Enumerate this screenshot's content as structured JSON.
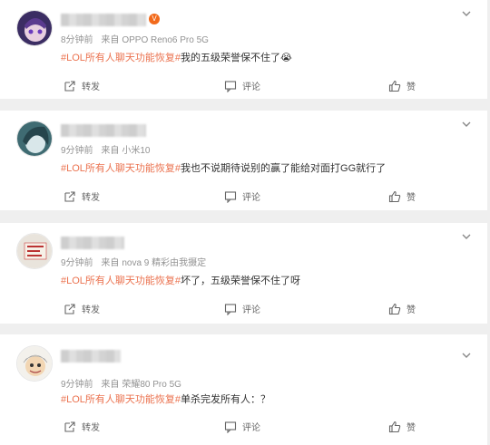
{
  "posts": [
    {
      "time": "8分钟前",
      "source_prefix": "来自",
      "source": "OPPO Reno6 Pro 5G",
      "topic": "#LOL所有人聊天功能恢复#",
      "text": "我的五级荣誉保不住了😭",
      "share_label": "转发",
      "comment_label": "评论",
      "like_label": "赞"
    },
    {
      "time": "9分钟前",
      "source_prefix": "来自",
      "source": "小米10",
      "topic": "#LOL所有人聊天功能恢复#",
      "text": "我也不说期待说别的赢了能给对面打GG就行了",
      "share_label": "转发",
      "comment_label": "评论",
      "like_label": "赞"
    },
    {
      "time": "9分钟前",
      "source_prefix": "来自",
      "source": "nova 9 精彩由我摄定",
      "topic": "#LOL所有人聊天功能恢复#",
      "text": "坏了，五级荣誉保不住了呀",
      "share_label": "转发",
      "comment_label": "评论",
      "like_label": "赞"
    },
    {
      "time": "9分钟前",
      "source_prefix": "来自",
      "source": "荣耀80 Pro 5G",
      "topic": "#LOL所有人聊天功能恢复#",
      "text": "单杀完发所有人：？",
      "share_label": "转发",
      "comment_label": "评论",
      "like_label": "赞"
    }
  ],
  "colors": {
    "topic": "#eb7350",
    "meta": "#939393",
    "background": "#efefef",
    "card": "#ffffff"
  },
  "icons": [
    "chevron-down-icon",
    "share-icon",
    "comment-icon",
    "like-icon"
  ]
}
